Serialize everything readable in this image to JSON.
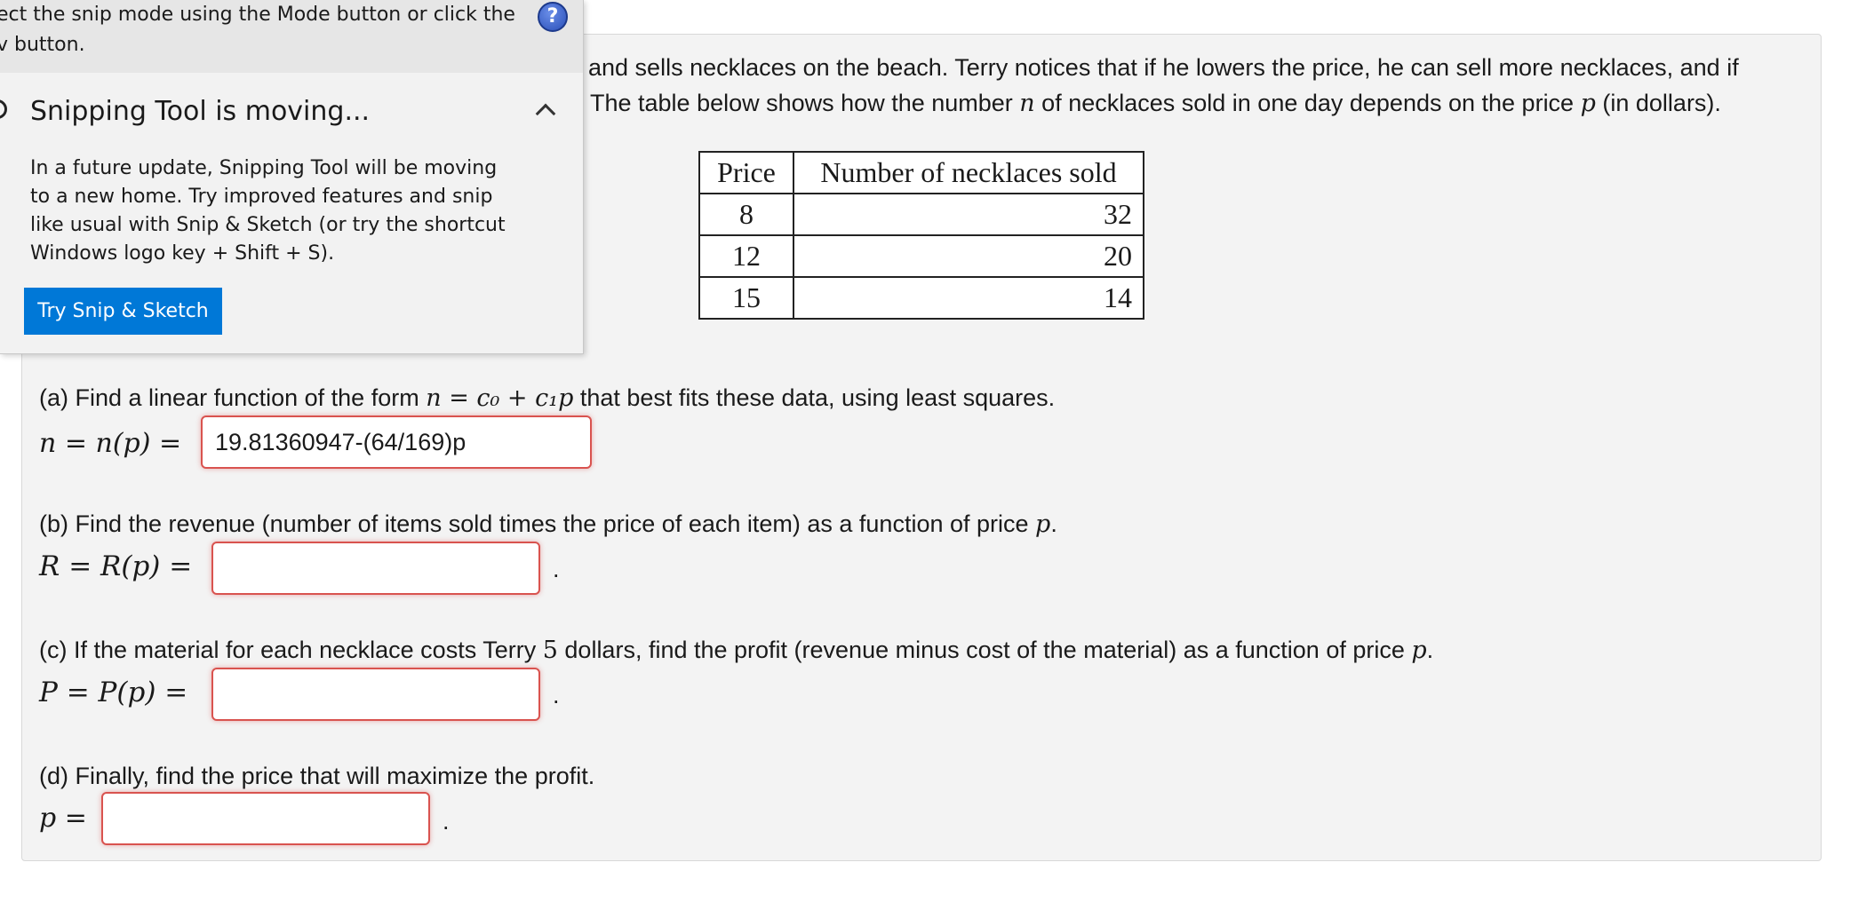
{
  "problem": {
    "intro_line1": "and sells necklaces on the beach. Terry notices that if he lowers the price, he can sell more necklaces, and if",
    "intro_line2_a": "The table below shows how the number ",
    "intro_line2_var": "n",
    "intro_line2_b": " of necklaces sold in one day depends on the price ",
    "intro_line2_var2": "p",
    "intro_line2_c": " (in dollars)."
  },
  "table": {
    "headers": [
      "Price",
      "Number of necklaces sold"
    ],
    "rows": [
      [
        "8",
        "32"
      ],
      [
        "12",
        "20"
      ],
      [
        "15",
        "14"
      ]
    ]
  },
  "parts": {
    "a": {
      "prompt_a": "(a) Find a linear function of the form ",
      "formula": "n = c₀ + c₁p",
      "prompt_b": " that best fits these data, using least squares.",
      "lhs": "n = n(p) =",
      "value": "19.81360947-(64/169)p"
    },
    "b": {
      "prompt_a": "(b) Find the revenue (number of items sold times the price of each item) as a function of price ",
      "prompt_var": "p",
      "prompt_b": ".",
      "lhs": "R = R(p) =",
      "value": "",
      "trail": "."
    },
    "c": {
      "prompt_a": "(c) If the material for each necklace costs Terry ",
      "cost": "5",
      "prompt_b": " dollars, find the profit (revenue minus cost of the material) as a function of price ",
      "prompt_var": "p",
      "prompt_c": ".",
      "lhs": "P = P(p) =",
      "value": "",
      "trail": "."
    },
    "d": {
      "prompt": "(d) Finally, find the price that will maximize the profit.",
      "lhs": "p =",
      "value": "",
      "trail": "."
    }
  },
  "snip": {
    "hint_line1": "ect the snip mode using the Mode button or click the",
    "hint_line2": "v button.",
    "help_glyph": "?",
    "title": "Snipping Tool is moving...",
    "body_lines": [
      "In a future update, Snipping Tool will be moving",
      "to a new home. Try improved features and snip",
      "like usual with Snip & Sketch (or try the shortcut",
      "Windows logo key + Shift + S)."
    ],
    "button": "Try Snip & Sketch"
  },
  "colors": {
    "accent_button": "#0078d7",
    "input_error_border": "#d9534f",
    "panel_bg": "#f3f3f3"
  }
}
